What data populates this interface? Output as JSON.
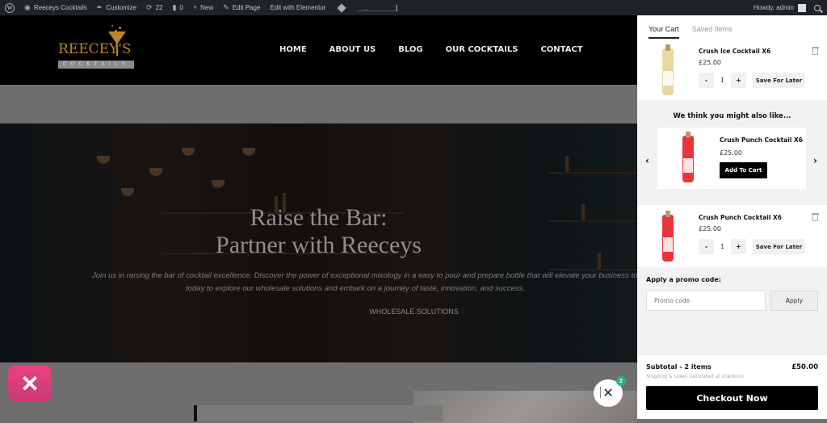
{
  "admin_bar": {
    "site_name": "Reeceys Cocktails",
    "customize": "Customize",
    "updates_count": "22",
    "comments_count": "0",
    "new": "New",
    "edit_page": "Edit Page",
    "edit_elementor": "Edit with Elementor",
    "howdy": "Howdy, admin"
  },
  "site": {
    "logo_text": "REECEY'S",
    "logo_sub": "COCKTAILS",
    "nav": [
      "HOME",
      "ABOUT US",
      "BLOG",
      "OUR COCKTAILS",
      "CONTACT"
    ]
  },
  "hero": {
    "title_line1": "Raise the Bar:",
    "title_line2": "Partner with Reeceys",
    "subtitle_line1": "Join us in raising the bar of cocktail excellence. Discover the power of exceptional mixology in a easy to pour and prepare bottle that will elevate your business to extr",
    "subtitle_line2": "today to explore our wholesale solutions and embark on a journey of taste, innovation, and success.",
    "cta": "WHOLESALE SOLUTIONS"
  },
  "cart_toggle": {
    "count": "2"
  },
  "cart": {
    "tabs": [
      "Your Cart",
      "Saved Items"
    ],
    "items": [
      {
        "name": "Crush Ice Cocktail X6",
        "price": "£25.00",
        "qty": "1",
        "save_label": "Save For Later",
        "color": "#e8d9a0"
      },
      {
        "name": "Crush Punch Cocktail X6",
        "price": "£25.00",
        "qty": "1",
        "save_label": "Save For Later",
        "color": "#e8353a"
      }
    ],
    "upsell": {
      "title": "We think you might also like...",
      "name": "Crush Punch Cocktail X6",
      "price": "£25.00",
      "button": "Add To Cart",
      "color": "#e8353a"
    },
    "promo": {
      "label": "Apply a promo code:",
      "placeholder": "Promo code",
      "button": "Apply"
    },
    "subtotal_label": "Subtotal - 2 items",
    "subtotal_value": "£50.00",
    "shipping_note": "Shipping & taxes calculated at checkout.",
    "checkout": "Checkout Now"
  }
}
